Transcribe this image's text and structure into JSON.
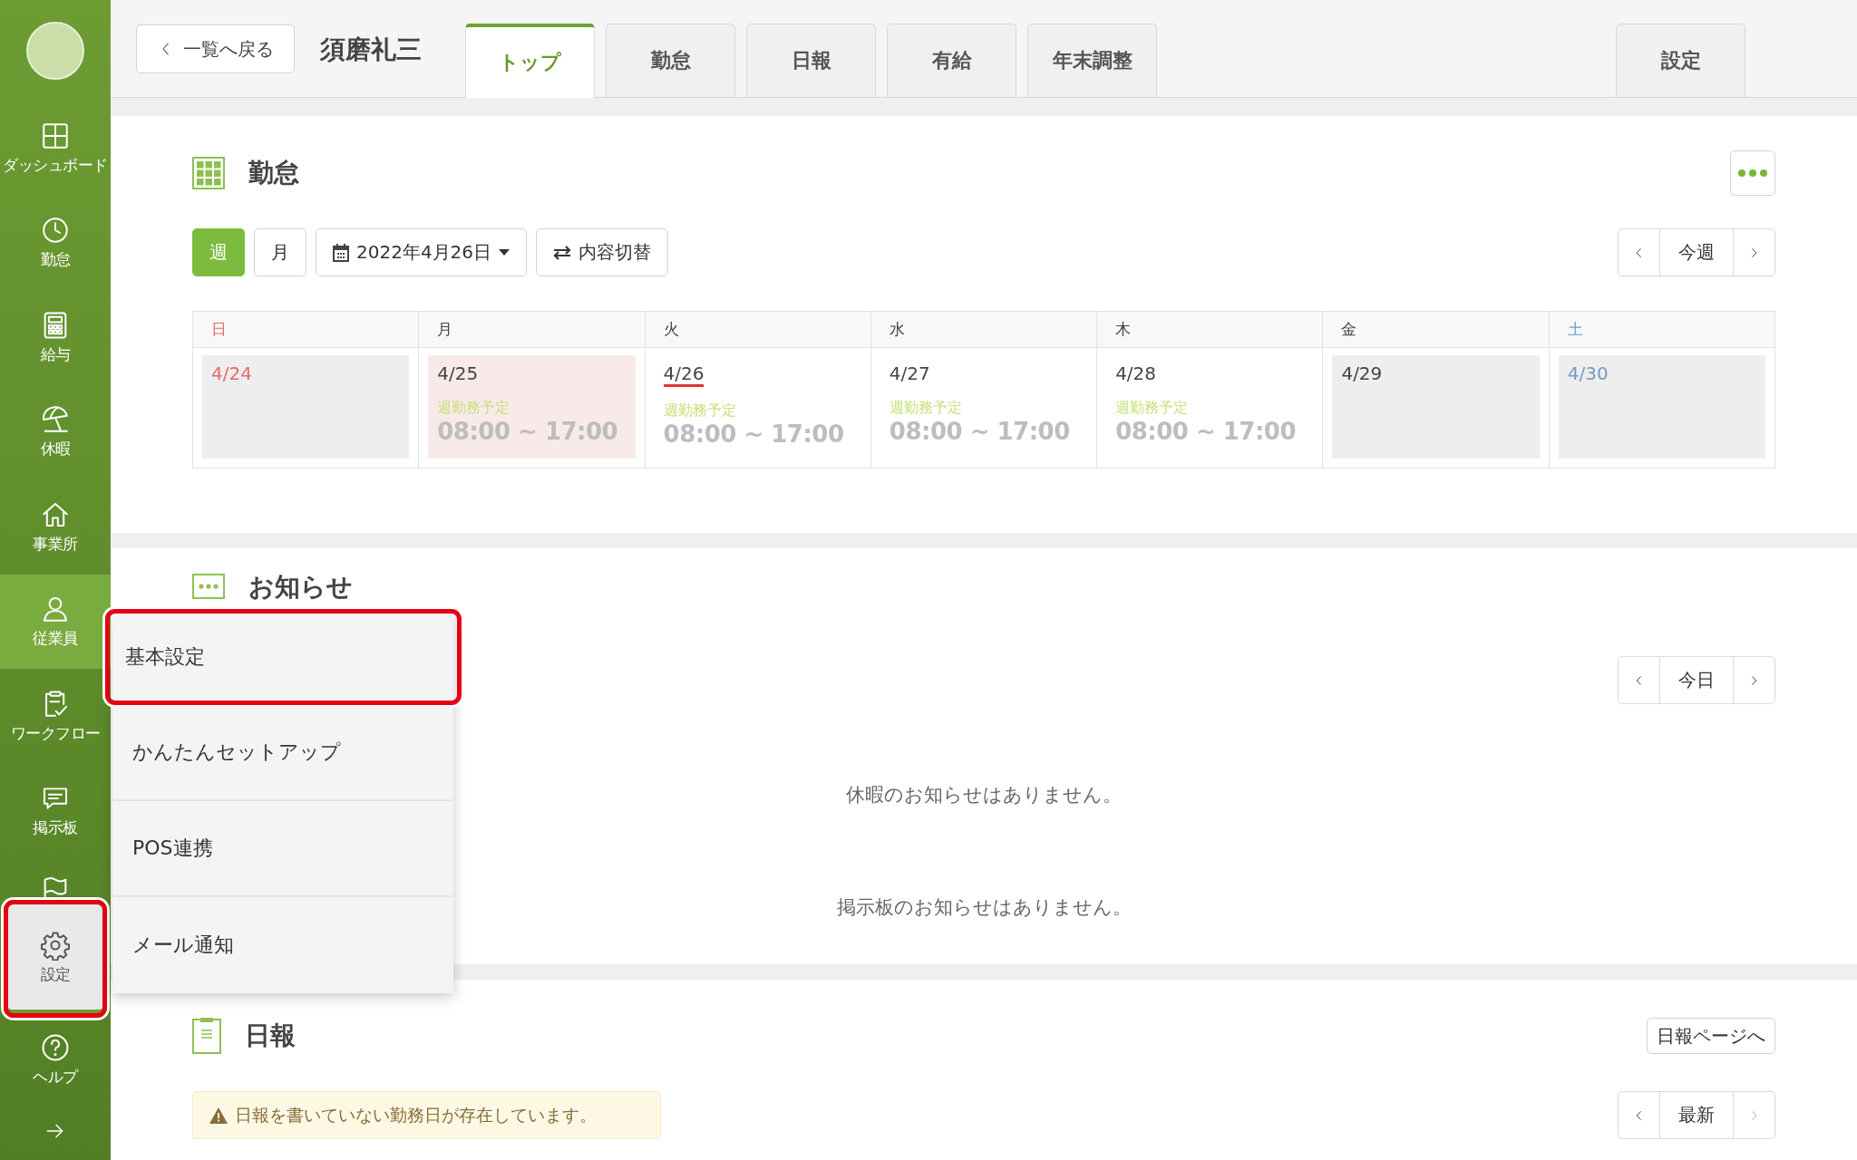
{
  "sidebar": {
    "items": [
      {
        "label": "ダッシュボード",
        "selected": false,
        "open": false,
        "highlighted": false
      },
      {
        "label": "勤怠",
        "selected": false,
        "open": false,
        "highlighted": false
      },
      {
        "label": "給与",
        "selected": false,
        "open": false,
        "highlighted": false
      },
      {
        "label": "休暇",
        "selected": false,
        "open": false,
        "highlighted": false
      },
      {
        "label": "事業所",
        "selected": false,
        "open": false,
        "highlighted": false
      },
      {
        "label": "従業員",
        "selected": true,
        "open": false,
        "highlighted": false
      },
      {
        "label": "ワークフロー",
        "selected": false,
        "open": false,
        "highlighted": false
      },
      {
        "label": "掲示板",
        "selected": false,
        "open": false,
        "highlighted": false
      },
      {
        "label": "設定",
        "selected": false,
        "open": true,
        "highlighted": true
      },
      {
        "label": "ヘルプ",
        "selected": false,
        "open": false,
        "highlighted": false
      }
    ]
  },
  "topbar": {
    "back_button": "一覧へ戻る",
    "employee_name": "須磨礼三",
    "tabs": [
      {
        "label": "トップ",
        "selected": true
      },
      {
        "label": "勤怠",
        "selected": false
      },
      {
        "label": "日報",
        "selected": false
      },
      {
        "label": "有給",
        "selected": false
      },
      {
        "label": "年末調整",
        "selected": false
      },
      {
        "label": "設定",
        "selected": false
      }
    ]
  },
  "attendance": {
    "title": "勤怠",
    "view_buttons": [
      {
        "label": "週",
        "selected": true
      },
      {
        "label": "月",
        "selected": false
      }
    ],
    "date_picker": "2022年4月26日",
    "switch_button": "内容切替",
    "nav": {
      "current": "今週",
      "next_disabled": false
    },
    "days": [
      {
        "label": "日",
        "color": "#e06c6c"
      },
      {
        "label": "月",
        "color": "#444444"
      },
      {
        "label": "火",
        "color": "#444444"
      },
      {
        "label": "水",
        "color": "#444444"
      },
      {
        "label": "木",
        "color": "#444444"
      },
      {
        "label": "金",
        "color": "#444444"
      },
      {
        "label": "土",
        "color": "#6f9bc8"
      }
    ],
    "cells": [
      {
        "date": "4/24",
        "kind": "off",
        "today": false
      },
      {
        "date": "4/25",
        "kind": "marked",
        "today": false,
        "schedule_label": "週勤務予定",
        "schedule_time": "08:00 ~ 17:00"
      },
      {
        "date": "4/26",
        "kind": "normal",
        "today": true,
        "schedule_label": "週勤務予定",
        "schedule_time": "08:00 ~ 17:00"
      },
      {
        "date": "4/27",
        "kind": "normal",
        "today": false,
        "schedule_label": "週勤務予定",
        "schedule_time": "08:00 ~ 17:00"
      },
      {
        "date": "4/28",
        "kind": "normal",
        "today": false,
        "schedule_label": "週勤務予定",
        "schedule_time": "08:00 ~ 17:00"
      },
      {
        "date": "4/29",
        "kind": "off",
        "today": false
      },
      {
        "date": "4/30",
        "kind": "off",
        "today": false
      }
    ]
  },
  "notices": {
    "title": "お知らせ",
    "nav": {
      "current": "今日",
      "next_disabled": false
    },
    "messages": [
      "休暇のお知らせはありません。",
      "掲示板のお知らせはありません。"
    ]
  },
  "daily_report": {
    "title": "日報",
    "page_button": "日報ページへ",
    "alert": "日報を書いていない勤務日が存在しています。",
    "nav": {
      "current": "最新",
      "next_disabled": true
    }
  },
  "settings_menu": {
    "items": [
      {
        "label": "基本設定",
        "highlighted": true
      },
      {
        "label": "かんたんセットアップ",
        "highlighted": false
      },
      {
        "label": "POS連携",
        "highlighted": false
      },
      {
        "label": "メール通知",
        "highlighted": false
      }
    ]
  }
}
